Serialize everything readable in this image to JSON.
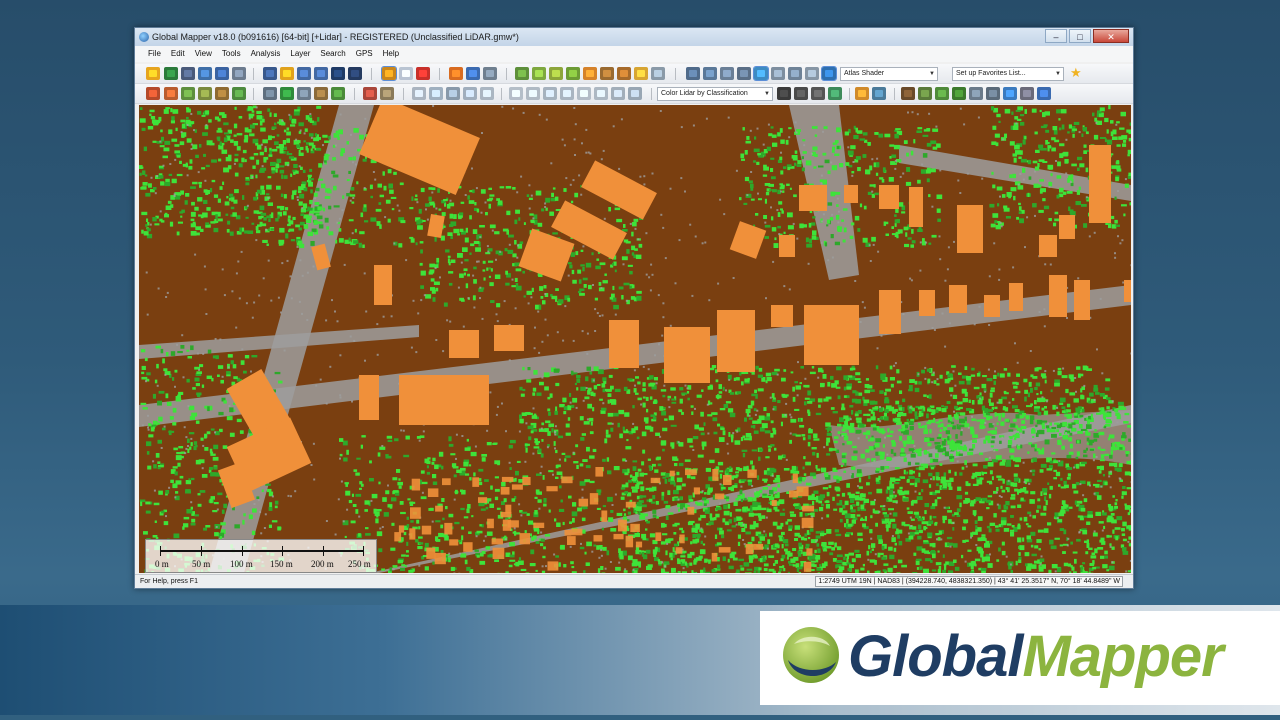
{
  "window": {
    "title": "Global Mapper v18.0 (b091616) [64-bit] [+Lidar] - REGISTERED (Unclassified LiDAR.gmw*)",
    "buttons": {
      "minimize": "–",
      "maximize": "□",
      "close": "✕"
    }
  },
  "menu": [
    "File",
    "Edit",
    "View",
    "Tools",
    "Analysis",
    "Layer",
    "Search",
    "GPS",
    "Help"
  ],
  "toolbar": {
    "shader_select": "Atlas Shader",
    "favorites_select": "Set up Favorites List...",
    "lidar_color_select": "Color Lidar by Classification"
  },
  "scale_bar": {
    "labels": [
      "0 m",
      "50 m",
      "100 m",
      "150 m",
      "200 m",
      "250 m"
    ]
  },
  "status": {
    "help_text": "For Help, press F1",
    "coordinates": "1:2749  UTM 19N | NAD83 | (394228.740, 4838321.350) | 43° 41' 25.3517\" N, 70° 18' 44.8489\" W"
  },
  "brand": {
    "part1": "Global",
    "part2": "Mapper",
    "colors": {
      "dark": "#1f3d63",
      "green": "#8cb43f"
    }
  },
  "map_colors": {
    "ground": "#7a3f10",
    "building": "#f0903a",
    "vegetation": "#3ee33a",
    "unclassified": "#9e9e9e"
  }
}
